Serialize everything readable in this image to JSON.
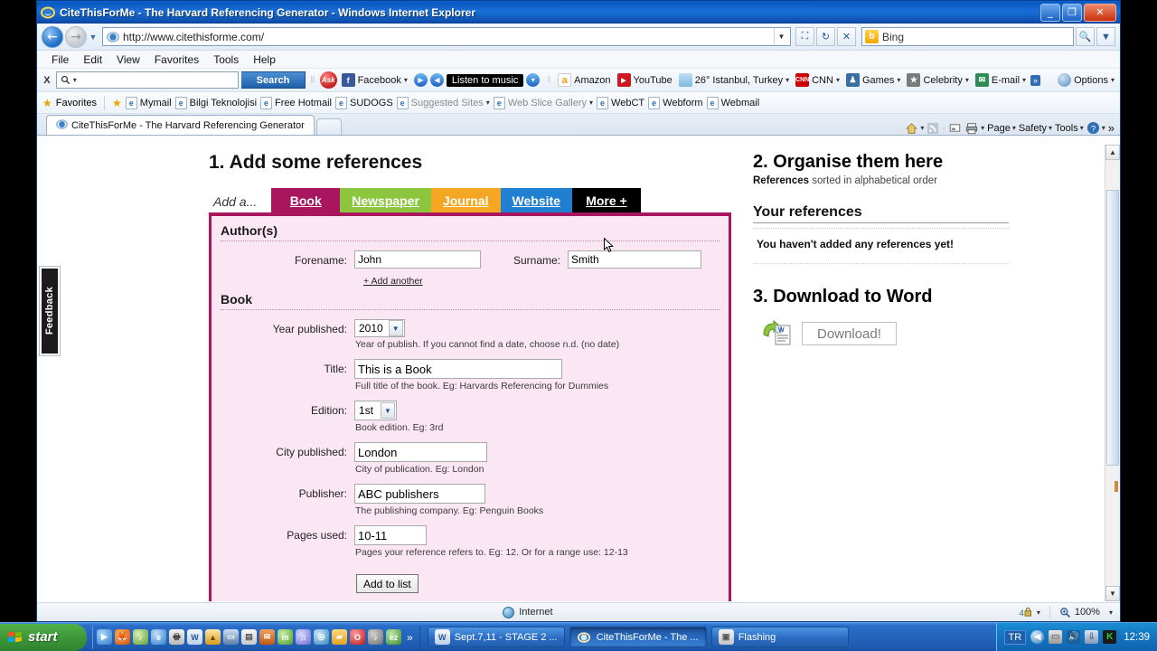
{
  "window": {
    "title": "CiteThisForMe - The Harvard Referencing Generator - Windows Internet Explorer",
    "minimize_label": "_",
    "maximize_label": "❐",
    "close_label": "✕"
  },
  "address_bar": {
    "url": "http://www.citethisforme.com/",
    "back_label": "←",
    "forward_label": "→",
    "history_caret": "▼",
    "url_dropdown": "▼",
    "refresh_label": "↻",
    "stop_label": "✕",
    "compat_label": "⛶",
    "search_value": "Bing",
    "search_go_label": "🔍",
    "search_caret": "▼"
  },
  "menu": {
    "items": [
      "File",
      "Edit",
      "View",
      "Favorites",
      "Tools",
      "Help"
    ]
  },
  "ask_toolbar": {
    "close_label": "X",
    "search_placeholder": "",
    "search_icon": "search-icon",
    "search_caret": "▾",
    "search_button": "Search",
    "ask_logo": "Ask",
    "items": [
      {
        "label": "Facebook",
        "icon": "facebook-icon",
        "caret": "▾"
      },
      {
        "label": "Listen to music",
        "icon": "play-icon",
        "caret": "▾"
      },
      {
        "label": "Amazon",
        "icon": "amazon-icon",
        "caret": ""
      },
      {
        "label": "YouTube",
        "icon": "youtube-icon",
        "caret": ""
      },
      {
        "label": "26° Istanbul, Turkey",
        "icon": "weather-icon",
        "caret": "▾"
      },
      {
        "label": "CNN",
        "icon": "cnn-icon",
        "caret": "▾"
      },
      {
        "label": "Games",
        "icon": "games-icon",
        "caret": "▾"
      },
      {
        "label": "Celebrity",
        "icon": "celebrity-icon",
        "caret": "▾"
      },
      {
        "label": "E-mail",
        "icon": "email-icon",
        "caret": "▾"
      }
    ],
    "overflow_label": "»",
    "options_label": "Options",
    "options_caret": "▾"
  },
  "favorites_bar": {
    "favorites_label": "Favorites",
    "items": [
      {
        "label": "Mymail",
        "caret": ""
      },
      {
        "label": "Bilgi Teknolojisi",
        "caret": ""
      },
      {
        "label": "Free Hotmail",
        "caret": ""
      },
      {
        "label": "SUDOGS",
        "caret": ""
      },
      {
        "label": "Suggested Sites",
        "caret": "▾",
        "dim": true
      },
      {
        "label": "Web Slice Gallery",
        "caret": "▾",
        "dim": true
      },
      {
        "label": "WebCT",
        "caret": ""
      },
      {
        "label": "Webform",
        "caret": ""
      },
      {
        "label": "Webmail",
        "caret": ""
      }
    ]
  },
  "tabs": {
    "page_tab": "CiteThisForMe - The Harvard Referencing Generator",
    "new_tab_label": ""
  },
  "command_bar": {
    "home_label": "",
    "home_caret": "▾",
    "feeds_label": "",
    "read_label": "",
    "print_label": "",
    "print_caret": "▾",
    "page_label": "Page",
    "page_caret": "▾",
    "safety_label": "Safety",
    "safety_caret": "▾",
    "tools_label": "Tools",
    "tools_caret": "▾",
    "help_caret": "▾",
    "overflow": "»"
  },
  "page": {
    "feedback_tab": "Feedback",
    "step1_title": "1. Add some references",
    "add_a_label": "Add a...",
    "type_tabs": [
      {
        "label": "Book",
        "color": "#a8165f",
        "active": true
      },
      {
        "label": "Newspaper",
        "color": "#8cc63e",
        "active": false
      },
      {
        "label": "Journal",
        "color": "#f5a623",
        "active": false
      },
      {
        "label": "Website",
        "color": "#1f7fd0",
        "active": false
      },
      {
        "label": "More +",
        "color": "#000000",
        "active": false
      }
    ],
    "authors_section_title": "Author(s)",
    "forename_label": "Forename:",
    "forename_value": "John",
    "surname_label": "Surname:",
    "surname_value": "Smith",
    "add_another_label": "+ Add another",
    "book_section_title": "Book",
    "fields": [
      {
        "name": "year-published",
        "label": "Year published:",
        "type": "select",
        "value": "2010",
        "hint": "Year of publish. If you cannot find a date, choose n.d. (no date)"
      },
      {
        "name": "title",
        "label": "Title:",
        "type": "text",
        "value": "This is a Book",
        "hint": "Full title of the book. Eg: Harvards Referencing for Dummies"
      },
      {
        "name": "edition",
        "label": "Edition:",
        "type": "select",
        "value": "1st",
        "hint": "Book edition. Eg: 3rd"
      },
      {
        "name": "city-published",
        "label": "City published:",
        "type": "text",
        "value": "London",
        "hint": "City of publication. Eg: London"
      },
      {
        "name": "publisher",
        "label": "Publisher:",
        "type": "text",
        "value": "ABC publishers",
        "hint": "The publishing company. Eg: Penguin Books"
      },
      {
        "name": "pages-used",
        "label": "Pages used:",
        "type": "text",
        "value": "10-11",
        "hint": "Pages your reference refers to. Eg: 12. Or for a range use: 12-13"
      }
    ],
    "add_to_list_label": "Add to list",
    "step2_title": "2. Organise them here",
    "step2_sub_bold": "References",
    "step2_sub_rest": " sorted in alphabetical order",
    "your_references_title": "Your references",
    "no_references_text": "You haven't added any references yet!",
    "step3_title": "3. Download to Word",
    "download_button_label": "Download!",
    "word_icon": "word-document-icon"
  },
  "scrollbar": {
    "up_label": "▲",
    "down_label": "▼"
  },
  "status_bar": {
    "zone_label": "Internet",
    "zone_icon": "globe-icon",
    "protected_icon": "protected-mode-icon",
    "protected_caret": "▾",
    "zoom_icon": "zoom-icon",
    "zoom_level": "100%",
    "zoom_caret": "▾"
  },
  "taskbar": {
    "start_label": "start",
    "quick_launch_icons": [
      "media-player-icon",
      "firefox-icon",
      "itunes-icon",
      "ie-icon",
      "printer-icon",
      "word-icon",
      "nero-icon",
      "monitor-icon",
      "explorer-icon",
      "outlook-icon",
      "msn-icon",
      "sound-icon",
      "antivirus-icon",
      "folder-icon",
      "opera-icon",
      "music-icon",
      "ez-icon"
    ],
    "quick_overflow": "»",
    "windows": [
      {
        "label": "Sept.7,11 - STAGE 2 ...",
        "icon": "word-icon",
        "active": false
      },
      {
        "label": "CiteThisForMe - The ...",
        "icon": "ie-icon",
        "active": true
      },
      {
        "label": "Flashing",
        "icon": "folder-icon",
        "active": false
      }
    ],
    "tray": {
      "language": "TR",
      "icons": [
        "show-desktop-icon",
        "network-icon",
        "volume-icon",
        "update-icon",
        "kaspersky-icon"
      ],
      "clock": "12:39"
    }
  }
}
